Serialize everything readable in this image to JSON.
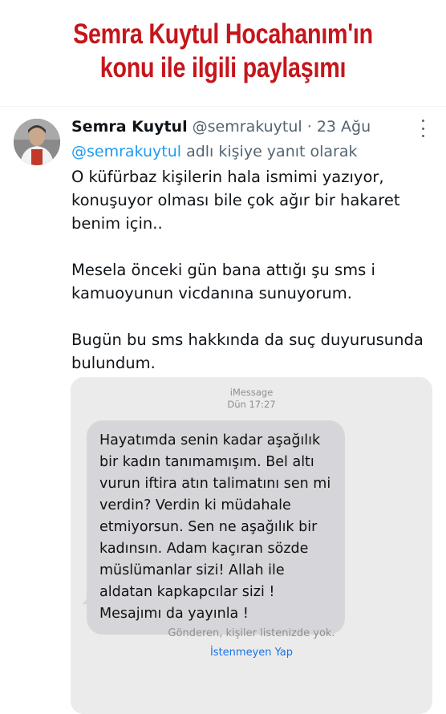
{
  "headline": {
    "line1": "Semra Kuytul Hocahanım'ın",
    "line2": "konu ile ilgili paylaşımı"
  },
  "tweet": {
    "author_name": "Semra Kuytul",
    "author_handle": "@semrakuytul",
    "separator": "·",
    "date": "23 Ağu",
    "reply_to_handle": "@semrakuytul",
    "reply_suffix": "adlı kişiye yanıt olarak",
    "text": "O küfürbaz kişilerin hala ismimi yazıyor, konuşuyor olması bile çok ağır bir hakaret benim için..\n\nMesela önceki gün bana attığı şu sms i kamuoyunun vicdanına sunuyorum.\n\nBugün bu sms hakkında da suç duyurusunda bulundum.",
    "more_icon": "more-vertical-icon"
  },
  "imessage": {
    "service": "iMessage",
    "timestamp": "Dün 17:27",
    "message": "Hayatımda senin kadar aşağılık bir kadın tanımamışım. Bel altı vurun iftira atın talimatını sen mi verdin? Verdin ki müdahale etmiyorsun. Sen ne aşağılık bir kadınsın. Adam kaçıran sözde müslümanlar sizi! Allah ile aldatan kapkapcılar sizi !\nMesajımı da yayınla !",
    "notice": "Gönderen, kişiler listenizde yok.",
    "action": "İstenmeyen Yap"
  },
  "colors": {
    "headline": "#c4161c",
    "link": "#1d9bf0",
    "secondary_text": "#536471",
    "bubble": "#d6d6da",
    "imessage_action": "#1a73e8"
  }
}
